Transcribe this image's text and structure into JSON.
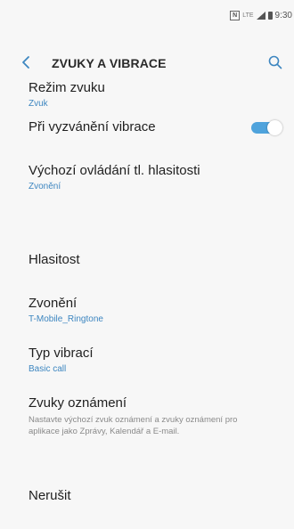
{
  "status_bar": {
    "nfc": "N",
    "network": "LTE",
    "time": "9:30"
  },
  "header": {
    "title": "ZVUKY A VIBRACE",
    "back_icon": "chevron-left-icon",
    "search_icon": "search-icon"
  },
  "colors": {
    "accent": "#3d86c0",
    "toggle_on": "#4fa3dc",
    "background": "#f7f7f7"
  },
  "settings": {
    "sound_mode": {
      "title": "Režim zvuku",
      "value": "Zvuk"
    },
    "vibrate_on_ring": {
      "title": "Při vyzvánění vibrace",
      "enabled": true
    },
    "volume_key_default": {
      "title": "Výchozí ovládání tl. hlasitosti",
      "value": "Zvonění"
    },
    "volume": {
      "title": "Hlasitost"
    },
    "ringtone": {
      "title": "Zvonění",
      "value": "T-Mobile_Ringtone"
    },
    "vibration_pattern": {
      "title": "Typ vibrací",
      "value": "Basic call"
    },
    "notification_sounds": {
      "title": "Zvuky oznámení",
      "description": "Nastavte výchozí zvuk oznámení a zvuky oznámení pro aplikace jako Zprávy, Kalendář a E-mail."
    },
    "do_not_disturb": {
      "title": "Nerušit"
    }
  }
}
